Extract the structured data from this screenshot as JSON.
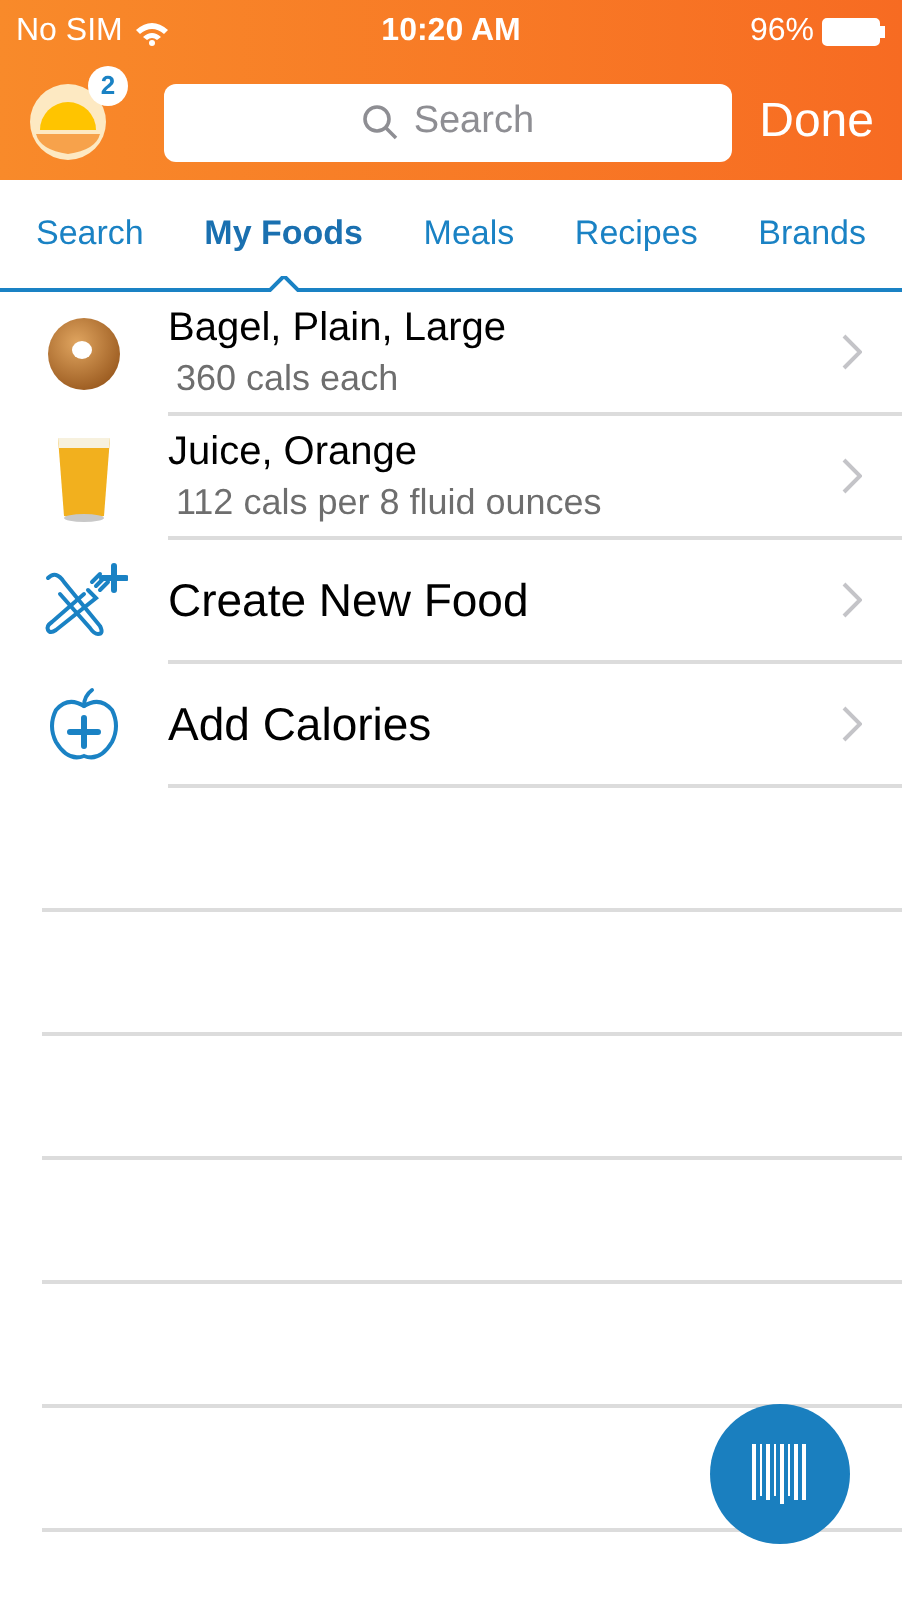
{
  "status_bar": {
    "carrier": "No SIM",
    "time": "10:20 AM",
    "battery": "96%"
  },
  "header": {
    "badge": "2",
    "search": {
      "placeholder": "Search"
    },
    "done": "Done"
  },
  "tabs": [
    {
      "label": "Search",
      "selected": false
    },
    {
      "label": "My Foods",
      "selected": true
    },
    {
      "label": "Meals",
      "selected": false
    },
    {
      "label": "Recipes",
      "selected": false
    },
    {
      "label": "Brands",
      "selected": false
    }
  ],
  "items": [
    {
      "kind": "bagel",
      "title": "Bagel, Plain, Large",
      "subtitle": "360 cals each"
    },
    {
      "kind": "juice",
      "title": "Juice, Orange",
      "subtitle": "112 cals per 8 fluid ounces"
    },
    {
      "kind": "create",
      "title": "Create New Food"
    },
    {
      "kind": "add",
      "title": "Add Calories"
    }
  ]
}
